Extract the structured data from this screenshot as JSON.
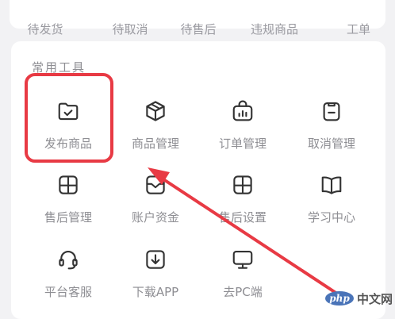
{
  "order_status": {
    "items": [
      "待发货",
      "待取消",
      "待售后",
      "违规商品",
      "工单"
    ]
  },
  "tools_section": {
    "title": "常用工具",
    "tools": [
      {
        "label": "发布商品",
        "icon": "folder-check-icon"
      },
      {
        "label": "商品管理",
        "icon": "box-icon"
      },
      {
        "label": "订单管理",
        "icon": "order-chart-icon"
      },
      {
        "label": "取消管理",
        "icon": "clipboard-icon"
      },
      {
        "label": "售后管理",
        "icon": "after-sales-icon"
      },
      {
        "label": "账户资金",
        "icon": "wallet-icon"
      },
      {
        "label": "售后设置",
        "icon": "after-sales-settings-icon"
      },
      {
        "label": "学习中心",
        "icon": "book-icon"
      },
      {
        "label": "平台客服",
        "icon": "headset-icon"
      },
      {
        "label": "下载APP",
        "icon": "download-icon"
      },
      {
        "label": "去PC端",
        "icon": "monitor-icon"
      }
    ]
  },
  "annotation": {
    "color": "#e83a44"
  },
  "watermark": {
    "logo_text": "php",
    "site": "中文网"
  }
}
